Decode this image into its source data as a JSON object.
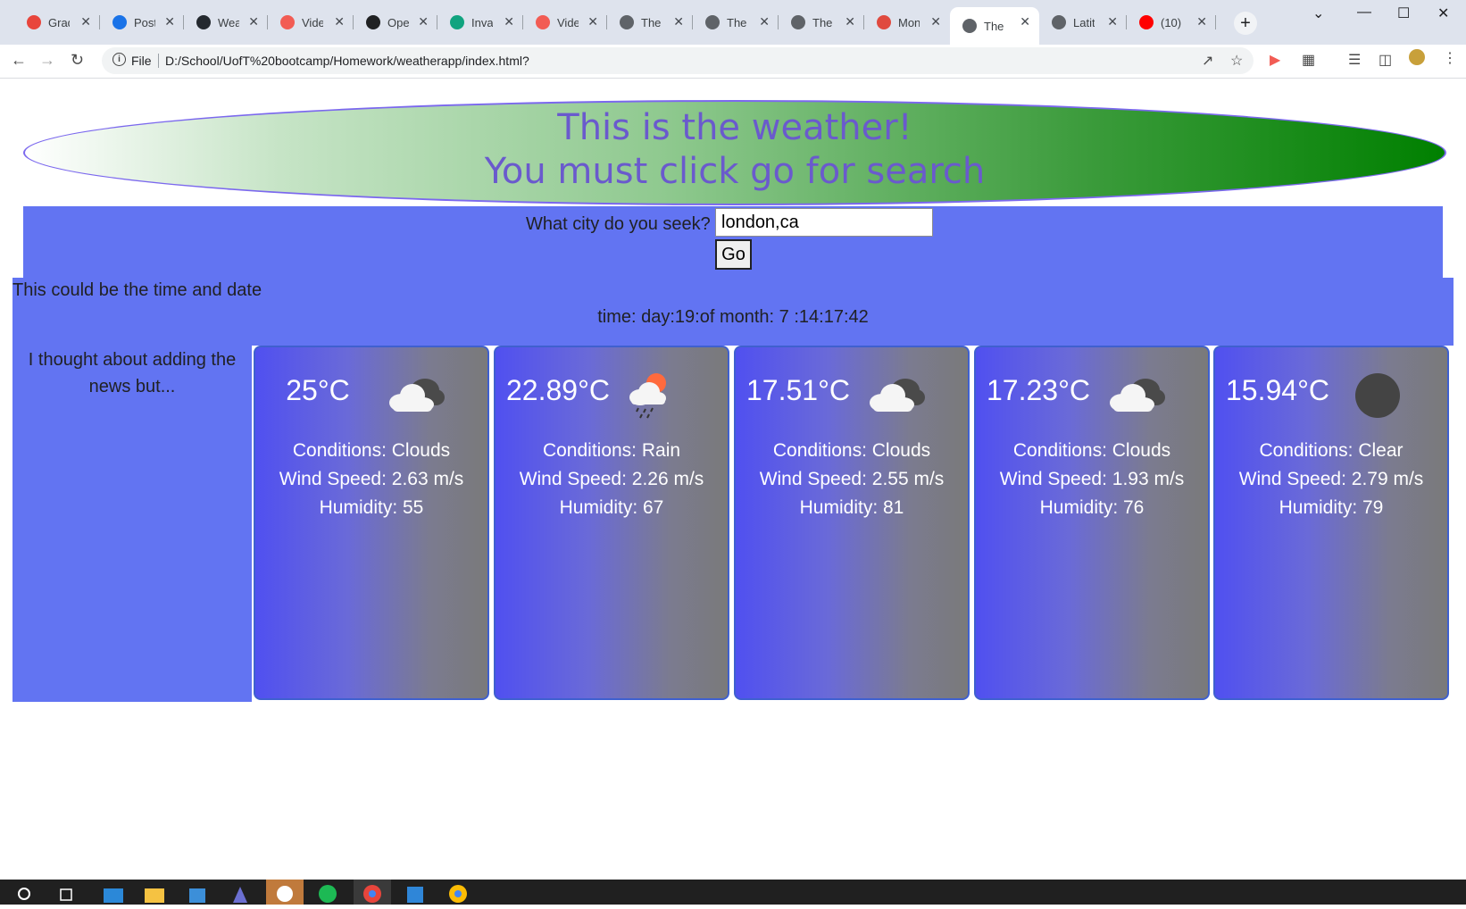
{
  "browser": {
    "tabs": [
      {
        "title": "Grad",
        "color": "#e8453c"
      },
      {
        "title": "Post",
        "color": "#1a73e8"
      },
      {
        "title": "Weat",
        "color": "#24292f"
      },
      {
        "title": "Vide",
        "color": "#f25c54"
      },
      {
        "title": "Oper",
        "color": "#202123"
      },
      {
        "title": "Inval",
        "color": "#10a37f"
      },
      {
        "title": "Vide",
        "color": "#f25c54"
      },
      {
        "title": "The",
        "color": "#5f6368"
      },
      {
        "title": "The",
        "color": "#5f6368"
      },
      {
        "title": "The",
        "color": "#5f6368"
      },
      {
        "title": "Mon",
        "color": "#e04a3f"
      },
      {
        "title": "The",
        "color": "#5f6368"
      },
      {
        "title": "Latit",
        "color": "#5f6368"
      },
      {
        "title": "(10)",
        "color": "#ff0000"
      }
    ],
    "active_tab_index": 11,
    "address": {
      "scheme": "File",
      "url": "D:/School/UofT%20bootcamp/Homework/weatherapp/index.html?"
    }
  },
  "page": {
    "header": {
      "line1": "This is the weather!",
      "line2": "You must click go for search"
    },
    "search": {
      "label": "What city do you seek?",
      "value": "london,ca",
      "button_label": "Go"
    },
    "datetime": {
      "caption": "This could be the time and date",
      "value": "time: day:19:of month: 7 :14:17:42"
    },
    "news": {
      "text": "I thought about adding the news but..."
    },
    "forecast": [
      {
        "temp": "25°C",
        "icon": "cloud-icon",
        "conditions": "Conditions: Clouds",
        "wind": "Wind Speed: 2.63 m/s",
        "humidity": "Humidity: 55"
      },
      {
        "temp": "22.89°C",
        "icon": "rain-icon",
        "conditions": "Conditions: Rain",
        "wind": "Wind Speed: 2.26 m/s",
        "humidity": "Humidity: 67"
      },
      {
        "temp": "17.51°C",
        "icon": "cloud-icon",
        "conditions": "Conditions: Clouds",
        "wind": "Wind Speed: 2.55 m/s",
        "humidity": "Humidity: 81"
      },
      {
        "temp": "17.23°C",
        "icon": "cloud-icon",
        "conditions": "Conditions: Clouds",
        "wind": "Wind Speed: 1.93 m/s",
        "humidity": "Humidity: 76"
      },
      {
        "temp": "15.94°C",
        "icon": "clear-icon",
        "conditions": "Conditions: Clear",
        "wind": "Wind Speed: 2.79 m/s",
        "humidity": "Humidity: 79"
      }
    ]
  },
  "colors": {
    "panel_blue": "#6274f2",
    "header_text": "#6a5acd",
    "header_green": "#008000"
  }
}
